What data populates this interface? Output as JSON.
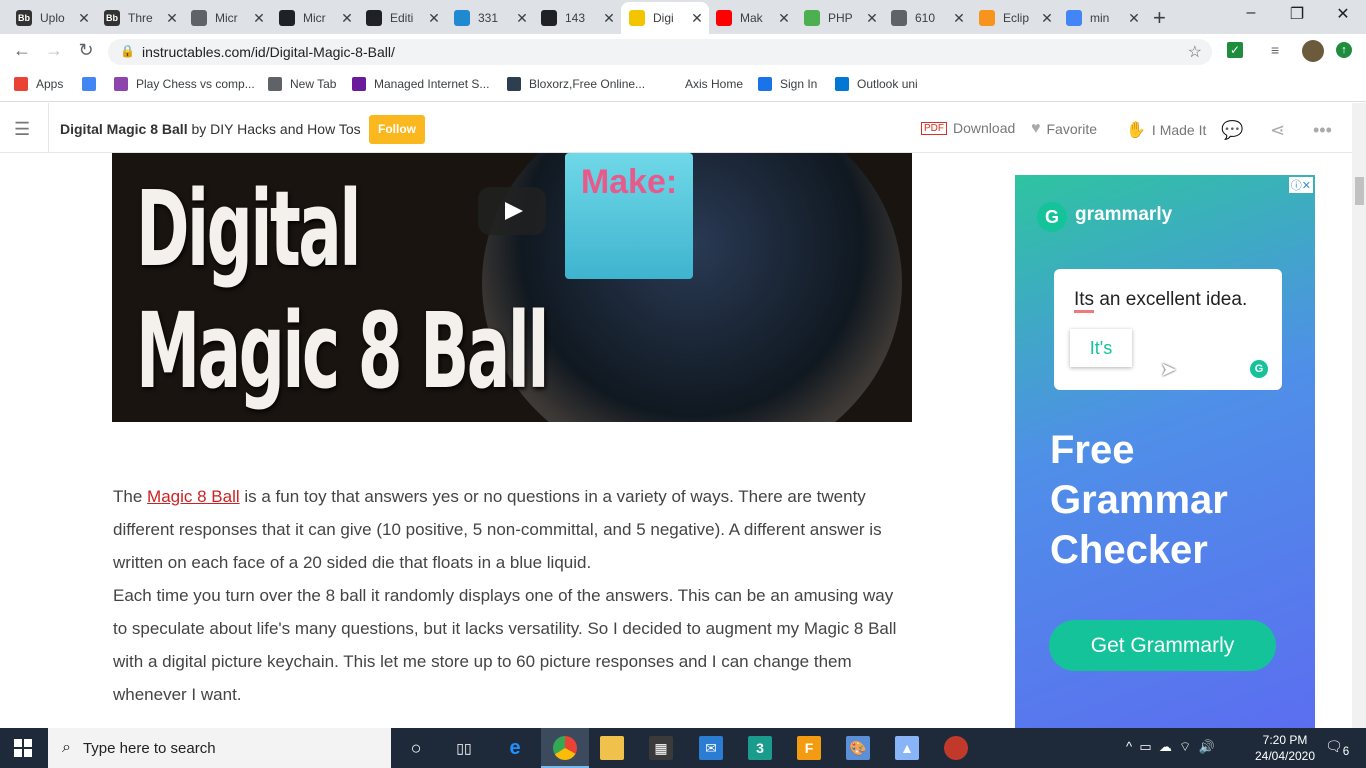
{
  "browser": {
    "tabs": [
      {
        "icon": "Bb",
        "title": "Uplo",
        "color": "#333333"
      },
      {
        "icon": "Bb",
        "title": "Thre",
        "color": "#333333"
      },
      {
        "icon": "globe-icon",
        "title": "Micr",
        "color": "#5f6368"
      },
      {
        "icon": "mic-icon",
        "title": "Micr",
        "color": "#202124"
      },
      {
        "icon": "github-icon",
        "title": "Editi",
        "color": "#202124"
      },
      {
        "icon": "hash-icon",
        "title": "331",
        "color": "#1f8ad1"
      },
      {
        "icon": "infinity-icon",
        "title": "143",
        "color": "#202124"
      },
      {
        "icon": "instructables-icon",
        "title": "Digi",
        "color": "#f3c500"
      },
      {
        "icon": "youtube-icon",
        "title": "Mak",
        "color": "#ff0000"
      },
      {
        "icon": "w3-icon",
        "title": "PHP",
        "color": "#4caf50"
      },
      {
        "icon": "globe-icon",
        "title": "610",
        "color": "#5f6368"
      },
      {
        "icon": "eclipse-icon",
        "title": "Eclip",
        "color": "#f7941e"
      },
      {
        "icon": "google-icon",
        "title": "min",
        "color": "#4285f4"
      }
    ],
    "active_tab": 7,
    "url": "instructables.com/id/Digital-Magic-8-Ball/",
    "bookmarks": [
      {
        "label": "Apps",
        "icon": "apps-grid-icon"
      },
      {
        "label": "",
        "icon": "google-icon"
      },
      {
        "label": "Play Chess vs comp...",
        "icon": "chess-icon"
      },
      {
        "label": "New Tab",
        "icon": "globe-icon"
      },
      {
        "label": "Managed Internet S...",
        "icon": "managed-icon"
      },
      {
        "label": "Bloxorz,Free Online...",
        "icon": "bloxorz-icon"
      },
      {
        "label": "Axis Home",
        "icon": ""
      },
      {
        "label": "Sign In",
        "icon": "signin-icon"
      },
      {
        "label": "Outlook uni",
        "icon": "outlook-icon"
      }
    ]
  },
  "site": {
    "title": "Digital Magic 8 Ball",
    "by": "by DIY Hacks and How Tos",
    "follow": "Follow",
    "actions": {
      "download": "Download",
      "favorite": "Favorite",
      "made_it": "I Made It"
    }
  },
  "video": {
    "title_line1": "Digital",
    "title_line2": "Magic 8 Ball",
    "make_logo": "Make:"
  },
  "article": {
    "p1_before": "The ",
    "p1_link": "Magic 8 Ball",
    "p1_after": " is a fun toy that answers yes or no questions in a variety of ways. There are twenty different responses that it can give (10 positive, 5 non-committal, and 5 negative). A different answer is written on each face of a 20 sided die that floats in a blue liquid.",
    "p2": "Each time you turn over the 8 ball it randomly displays one of the answers. This can be an amusing way to speculate about life's many questions, but it lacks versatility. So I decided to augment my Magic 8 Ball with a digital picture keychain. This let me store up to 60 picture responses and I can change them whenever I want."
  },
  "ad": {
    "brand": "grammarly",
    "sample_wrong": "Its",
    "sample_rest": " an excellent idea.",
    "suggestion": "It's",
    "headline": "Free Grammar Checker",
    "cta": "Get Grammarly"
  },
  "taskbar": {
    "search_placeholder": "Type here to search",
    "time": "7:20 PM",
    "date": "24/04/2020",
    "notification_count": "6"
  }
}
